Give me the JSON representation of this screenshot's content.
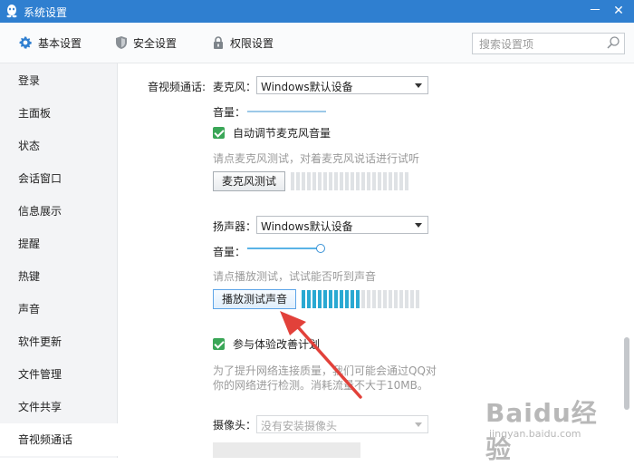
{
  "window": {
    "title": "系统设置",
    "minimize": "－",
    "close": "✕"
  },
  "tabs": [
    {
      "label": "基本设置",
      "icon": "gear-icon",
      "active": true
    },
    {
      "label": "安全设置",
      "icon": "shield-icon",
      "active": false
    },
    {
      "label": "权限设置",
      "icon": "lock-icon",
      "active": false
    }
  ],
  "search": {
    "placeholder": "搜索设置项"
  },
  "sidebar": {
    "items": [
      {
        "label": "登录"
      },
      {
        "label": "主面板"
      },
      {
        "label": "状态"
      },
      {
        "label": "会话窗口"
      },
      {
        "label": "信息展示"
      },
      {
        "label": "提醒"
      },
      {
        "label": "热键"
      },
      {
        "label": "声音"
      },
      {
        "label": "软件更新"
      },
      {
        "label": "文件管理"
      },
      {
        "label": "文件共享"
      },
      {
        "label": "音视频通话"
      }
    ],
    "active_index": 11
  },
  "av": {
    "section_label": "音视频通话:",
    "mic": {
      "label": "麦克风：",
      "device": "Windows默认设备",
      "volume_label": "音量：",
      "auto_adjust": {
        "label": "自动调节麦克风音量",
        "checked": true
      },
      "hint": "请点麦克风测试，对着麦克风说话进行试听",
      "test_button": "麦克风测试",
      "meter_level": 0,
      "meter_segments": 22
    },
    "speaker": {
      "label": "扬声器：",
      "device": "Windows默认设备",
      "volume_label": "音量：",
      "volume_fraction": 1.0,
      "hint": "请点播放测试，试试能否听到声音",
      "test_button": "播放测试声音",
      "meter_level": 11,
      "meter_segments": 22
    },
    "improve": {
      "label": "参与体验改善计划",
      "checked": true,
      "desc_line1": "为了提升网络连接质量，我们可能会通过QQ对",
      "desc_line2": "你的网络进行检测。消耗流量不大于10MB。"
    },
    "camera": {
      "label": "摄像头：",
      "device": "没有安装摄像头"
    }
  },
  "watermark": {
    "text": "Baidu经验",
    "sub": "jingyan.baidu.com"
  },
  "colors": {
    "titlebar": "#2f7fd0",
    "accent": "#2aa9d2",
    "check": "#3aa657",
    "arrow": "#e2413a"
  }
}
